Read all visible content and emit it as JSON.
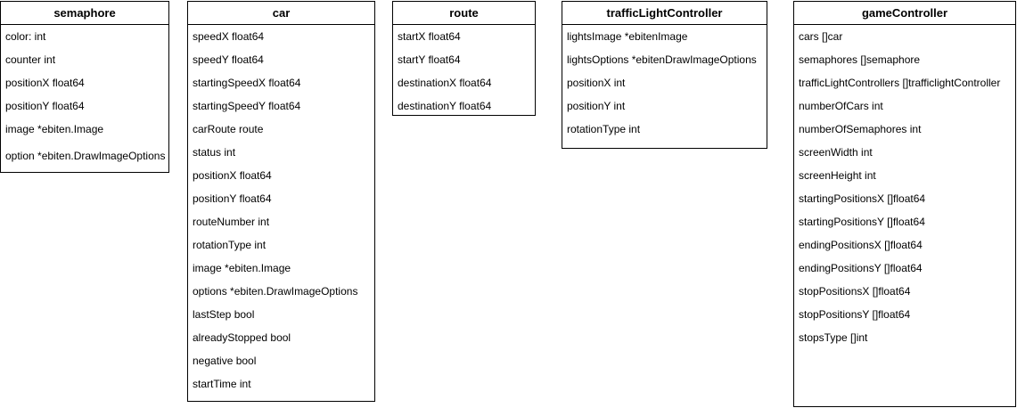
{
  "classes": {
    "semaphore": {
      "name": "semaphore",
      "fields": [
        "color: int",
        "counter int",
        "positionX float64",
        "positionY float64",
        "image *ebiten.Image",
        "option *ebiten.DrawImageOptions"
      ]
    },
    "car": {
      "name": "car",
      "fields": [
        "speedX float64",
        "speedY float64",
        "startingSpeedX float64",
        "startingSpeedY float64",
        "carRoute route",
        "status int",
        "positionX float64",
        "positionY float64",
        "routeNumber int",
        "rotationType int",
        "image *ebiten.Image",
        "options *ebiten.DrawImageOptions",
        "lastStep bool",
        "alreadyStopped bool",
        "negative bool",
        "startTime int"
      ]
    },
    "route": {
      "name": "route",
      "fields": [
        "startX float64",
        "startY float64",
        "destinationX float64",
        "destinationY float64"
      ]
    },
    "trafficLightController": {
      "name": "trafficLightController",
      "fields": [
        "lightsImage *ebitenImage",
        "lightsOptions *ebitenDrawImageOptions",
        "positionX int",
        "positionY int",
        "rotationType int"
      ]
    },
    "gameController": {
      "name": "gameController",
      "fields": [
        "cars []car",
        "semaphores []semaphore",
        "trafficLightControllers []trafficlightController",
        "numberOfCars int",
        "numberOfSemaphores int",
        "screenWidth int",
        "screenHeight int",
        "startingPositionsX []float64",
        "startingPositionsY []float64",
        "endingPositionsX []float64",
        "endingPositionsY []float64",
        "stopPositionsX []float64",
        "stopPositionsY []float64",
        "stopsType []int"
      ]
    }
  }
}
